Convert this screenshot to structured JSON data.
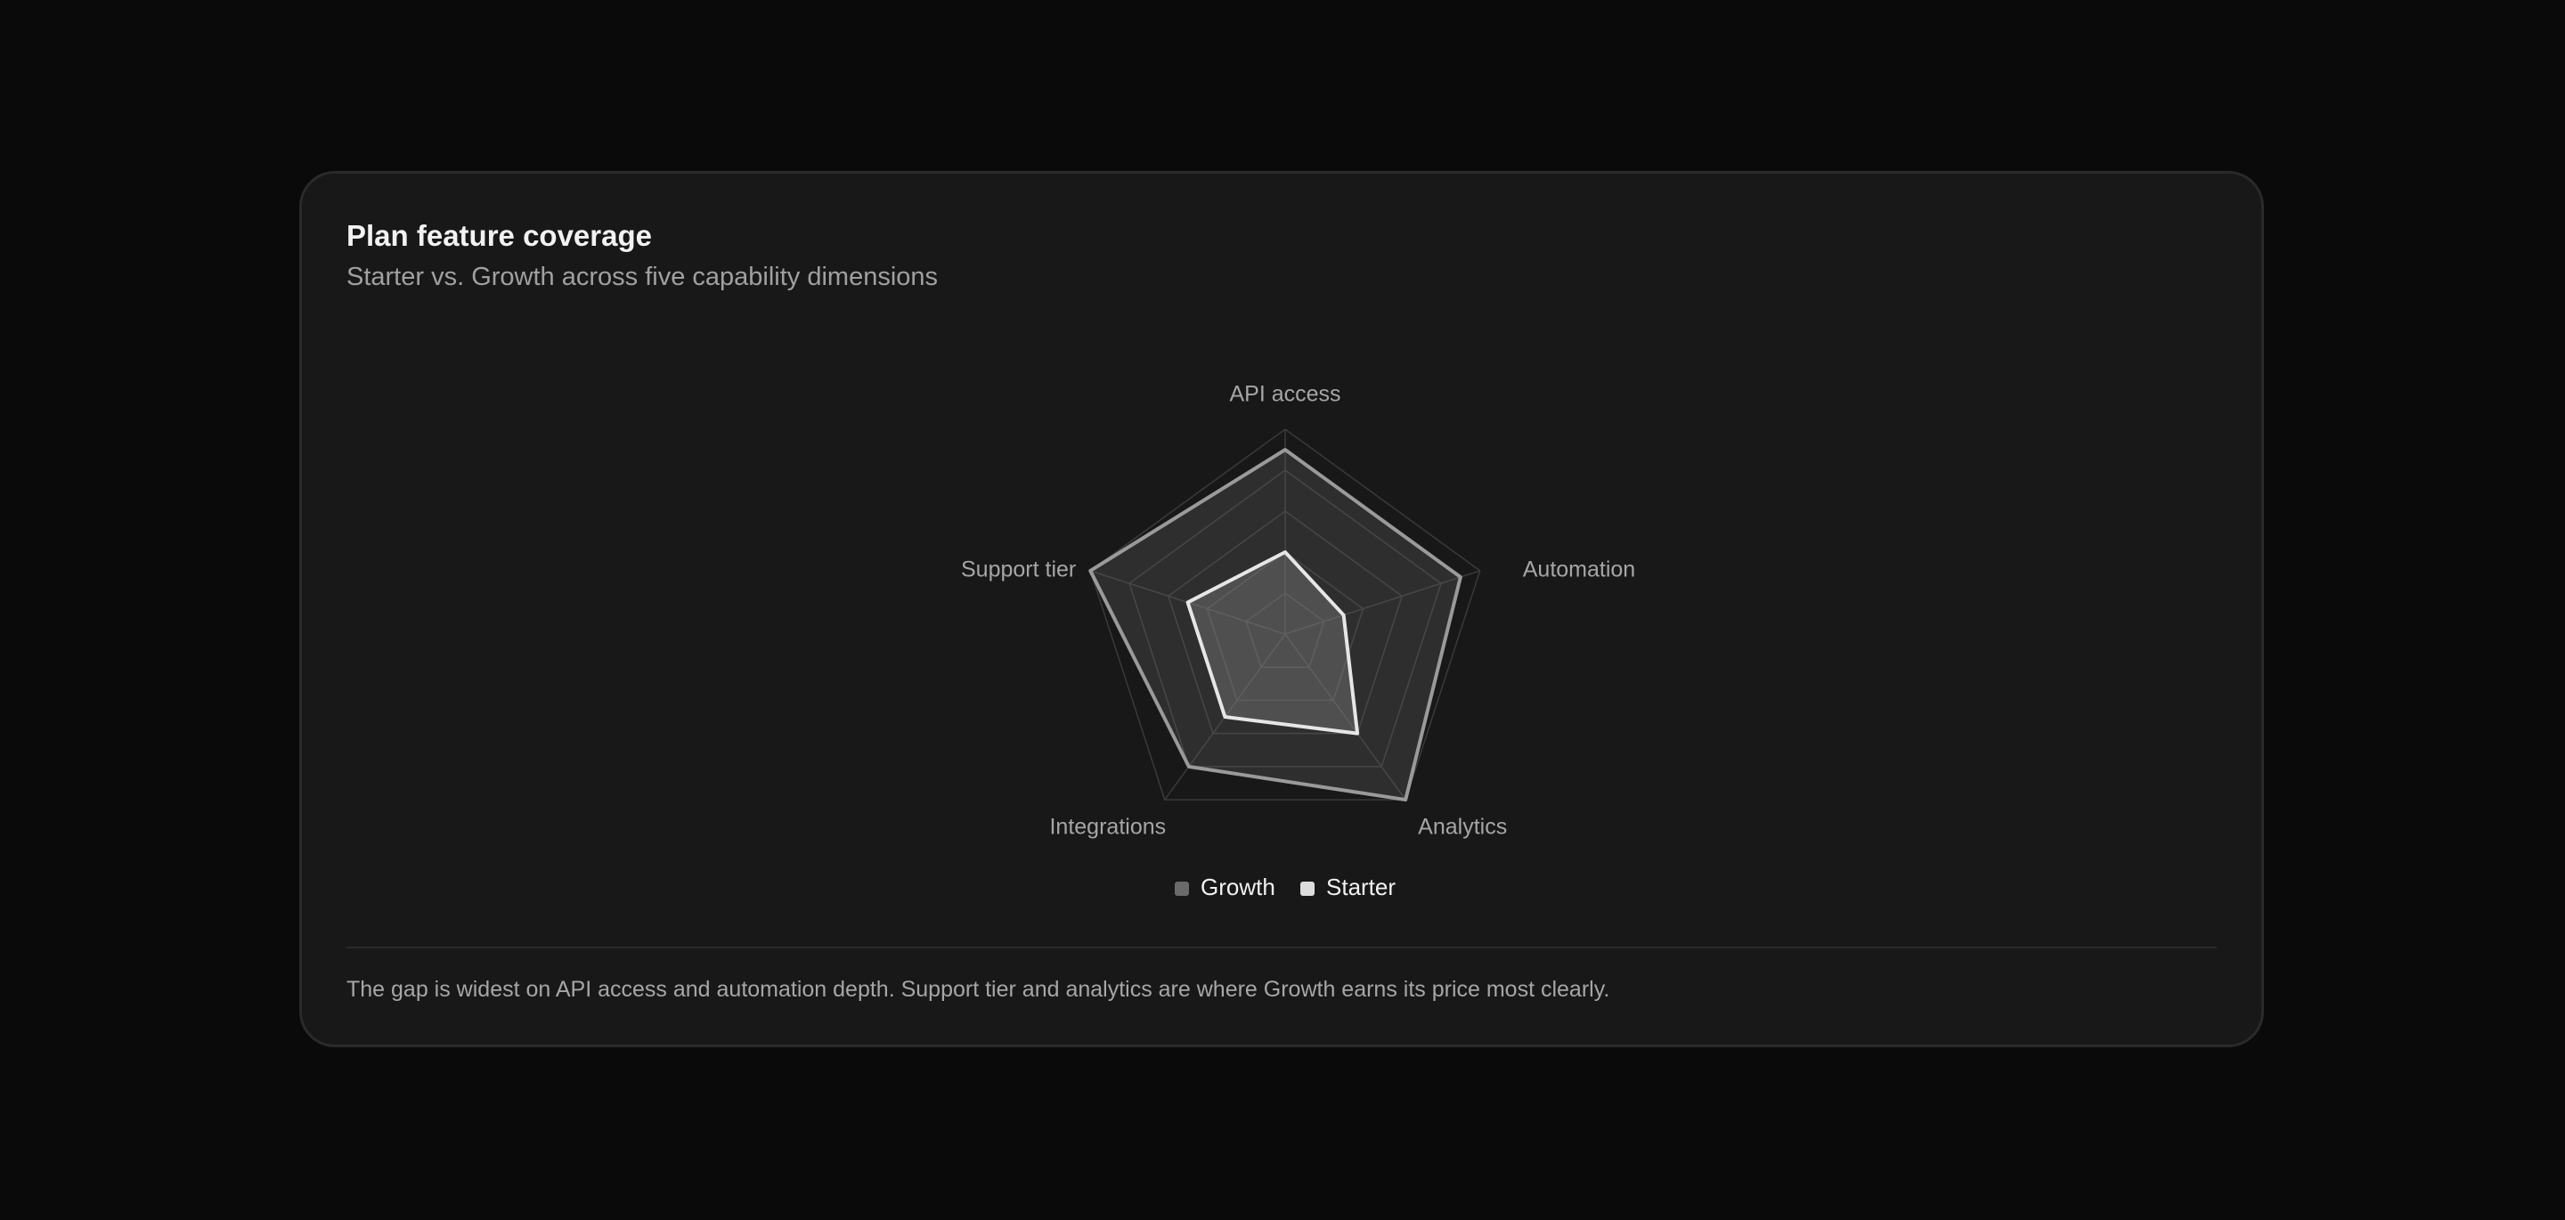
{
  "card": {
    "title": "Plan feature coverage",
    "subtitle": "Starter vs. Growth across five capability dimensions",
    "footnote": "The gap is widest on API access and automation depth. Support tier and analytics are where Growth earns its price most clearly."
  },
  "chart_data": {
    "type": "radar",
    "axes": [
      "API access",
      "Automation",
      "Analytics",
      "Integrations",
      "Support tier"
    ],
    "range": [
      0,
      5
    ],
    "grid_levels": 5,
    "grid": true,
    "legend_position": "bottom-center",
    "series": [
      {
        "name": "Growth",
        "values": [
          4.5,
          4.5,
          5,
          4,
          5
        ],
        "color": "#6a6a6a"
      },
      {
        "name": "Starter",
        "values": [
          2,
          1.5,
          3,
          2.5,
          2.5
        ],
        "color": "#e8e8e8"
      }
    ]
  },
  "colors": {
    "page_background": "#0a0a0a",
    "card_background": "#181818",
    "grid": "#3a3a3a",
    "axis_label": "#a6a6a6",
    "legend_text": "#f2f2f2"
  }
}
